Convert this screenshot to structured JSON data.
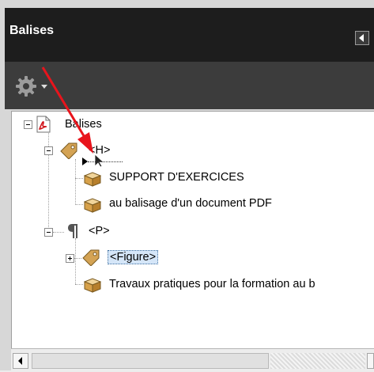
{
  "panel": {
    "title": "Balises"
  },
  "toolbar": {
    "options_icon": "gear-icon",
    "options_caret": "chevron-down-icon"
  },
  "tree": {
    "root": "Balises",
    "nodes": [
      {
        "label": "<H>",
        "icon": "tag-icon"
      },
      {
        "label": "SUPPORT D'EXERCICES",
        "icon": "box-icon"
      },
      {
        "label": "au balisage d'un document PDF",
        "icon": "box-icon"
      },
      {
        "label": "<P>",
        "icon": "paragraph-icon"
      },
      {
        "label": "<Figure>",
        "icon": "tag-icon",
        "selected": true
      },
      {
        "label": "Travaux pratiques pour la formation au b",
        "icon": "box-icon"
      }
    ]
  },
  "colors": {
    "header_bg": "#1d1d1d",
    "toolbar_bg": "#3c3c3c",
    "selection_bg": "#d5e6f8",
    "annotation_arrow": "#e8141c"
  }
}
